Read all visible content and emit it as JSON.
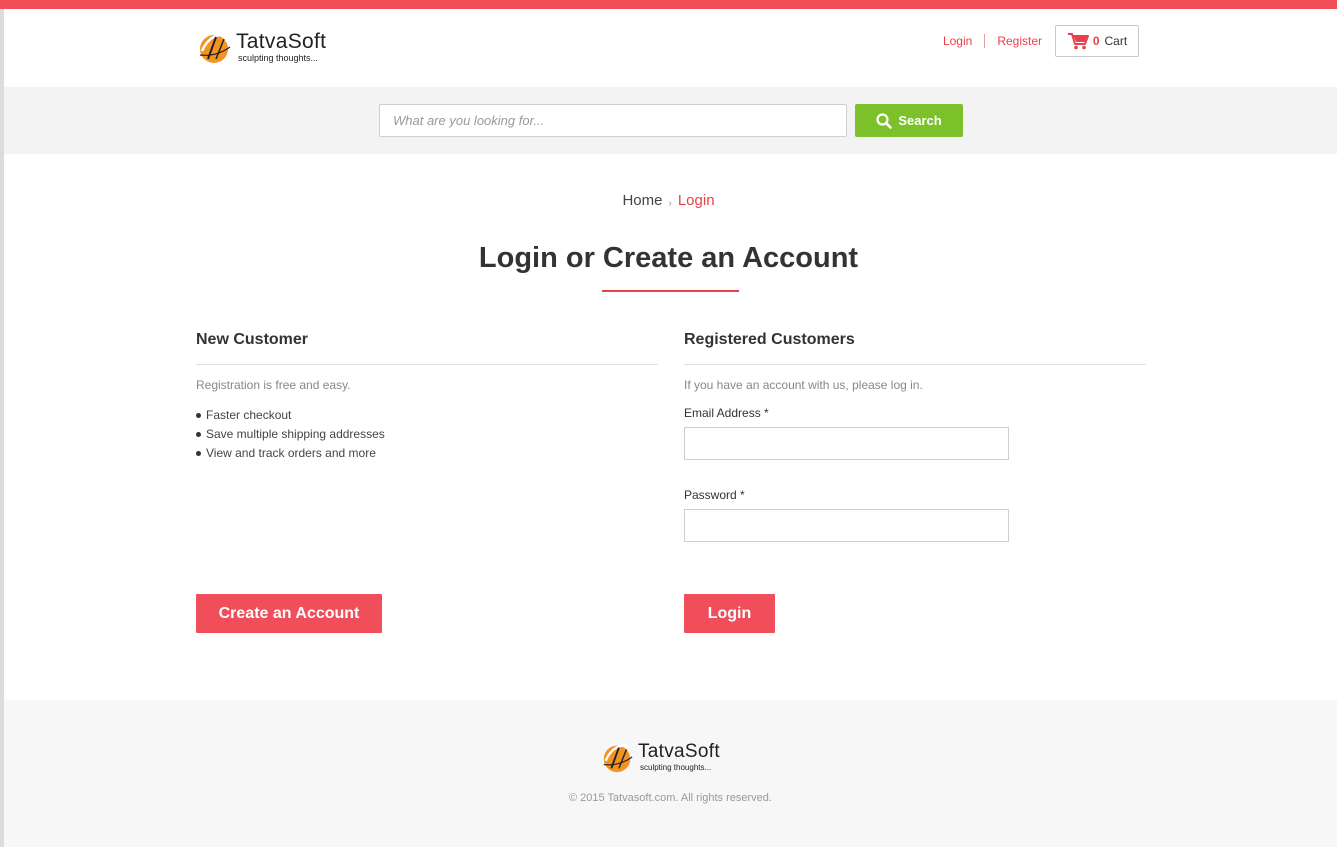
{
  "brand": {
    "name": "TatvaSoft",
    "tagline": "sculpting thoughts...",
    "accent_color": "#f04e5a",
    "search_color": "#7cc02a"
  },
  "header": {
    "login_label": "Login",
    "register_label": "Register",
    "cart_count": "0",
    "cart_label": "Cart"
  },
  "search": {
    "placeholder": "What are you looking for...",
    "button_label": "Search"
  },
  "breadcrumb": {
    "home": "Home",
    "separator": "›",
    "current": "Login"
  },
  "page": {
    "title": "Login or Create an Account"
  },
  "new_customer": {
    "heading": "New Customer",
    "intro": "Registration is free and easy.",
    "benefits": [
      "Faster checkout",
      "Save multiple shipping addresses",
      "View and track orders and more"
    ],
    "button_label": "Create an Account"
  },
  "registered": {
    "heading": "Registered Customers",
    "intro": "If you have an account with us, please log in.",
    "email_label": "Email Address *",
    "email_value": "",
    "password_label": "Password *",
    "password_value": "",
    "button_label": "Login"
  },
  "footer": {
    "copyright": "© 2015 Tatvasoft.com. All rights reserved."
  }
}
